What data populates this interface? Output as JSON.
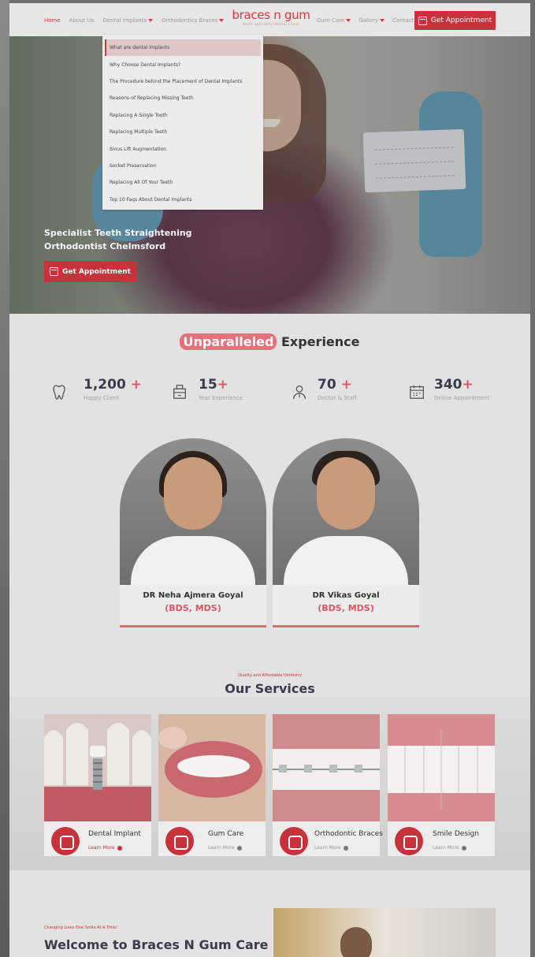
{
  "header": {
    "nav_left": [
      {
        "label": "Home",
        "active": true,
        "has_caret": false
      },
      {
        "label": "About Us",
        "active": false,
        "has_caret": false
      },
      {
        "label": "Dental Implants",
        "active": false,
        "has_caret": true
      },
      {
        "label": "Orthodontics Braces",
        "active": false,
        "has_caret": true
      }
    ],
    "logo": {
      "word": "braces n gum",
      "tagline": "multi specialty dental clinic"
    },
    "nav_right": [
      {
        "label": "Gum Care",
        "has_caret": true
      },
      {
        "label": "Gallery",
        "has_caret": true
      },
      {
        "label": "Contact",
        "has_caret": false
      }
    ],
    "cta_label": "Get Appointment"
  },
  "dropdown": {
    "items": [
      "What are dental Implants",
      "Why Choose Dental Implants?",
      "The Procedure behind the Placement of Dental Implants",
      "Reasons-of Replacing Missing Teeth",
      "Replacing A Single Tooth",
      "Replacing Multiple Teeth",
      "Sinus Lift Augmentation",
      "Socket Preservation",
      "Replacing All Of Your Teeth",
      "Top 10 Faqs About Dental Implants"
    ]
  },
  "hero": {
    "title_line1": "Specialist Teeth Straightening",
    "title_line2": "Orthodontist Chelmsford",
    "button_label": "Get Appointment"
  },
  "experience": {
    "title_highlight": "Unparalleled",
    "title_rest": " Experience",
    "stats": [
      {
        "icon": "tooth-icon",
        "value": "1,200",
        "plus": "+",
        "label": "Happy Client"
      },
      {
        "icon": "building-icon",
        "value": "15",
        "plus": "+",
        "label": "Year Experience"
      },
      {
        "icon": "doctor-icon",
        "value": "70",
        "plus": "+",
        "label": "Doctor & Staff"
      },
      {
        "icon": "calendar-icon",
        "value": "340",
        "plus": "+",
        "label": "Online Appointment"
      }
    ]
  },
  "doctors": [
    {
      "name": "DR Neha Ajmera Goyal",
      "degree": "(BDS, MDS)"
    },
    {
      "name": "DR Vikas Goyal",
      "degree": "(BDS, MDS)"
    }
  ],
  "services": {
    "kicker": "Quality and Affordable Dentistry",
    "title": "Our Services",
    "items": [
      {
        "name": "Dental Implant",
        "more": "Learn More"
      },
      {
        "name": "Gum Care",
        "more": "Learn More"
      },
      {
        "name": "Orthodontic Braces",
        "more": "Learn More"
      },
      {
        "name": "Smile Design",
        "more": "Learn More"
      }
    ]
  },
  "welcome": {
    "kicker": "Changing Lives One Smile At A Time!",
    "title": "Welcome to Braces N Gum Care"
  },
  "colors": {
    "brand_red": "#c8323a",
    "accent_pink": "#e25560",
    "text_dark": "#3b3b4e"
  }
}
